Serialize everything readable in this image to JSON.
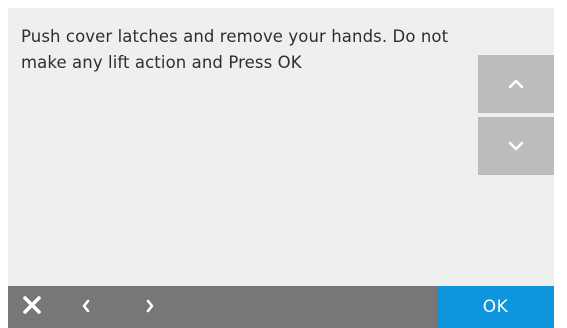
{
  "dialog": {
    "message": "Push cover latches and remove your hands. Do not make any lift action and Press OK"
  },
  "scroll": {
    "up_icon": "chevron-up-icon",
    "down_icon": "chevron-down-icon"
  },
  "bottom_bar": {
    "close_icon": "close-icon",
    "back_icon": "chevron-left-icon",
    "forward_icon": "chevron-right-icon",
    "ok_label": "OK"
  },
  "colors": {
    "screen_bg": "#efefef",
    "scroll_button": "#bcbcbc",
    "bottom_bar": "#777777",
    "ok_button": "#0e95dd",
    "text": "#2e2e2e"
  }
}
